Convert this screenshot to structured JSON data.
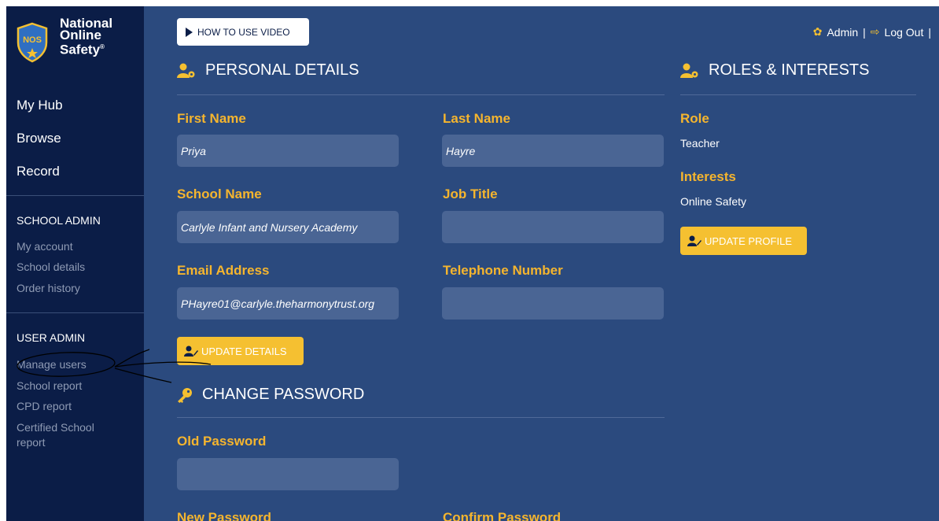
{
  "brand": {
    "badge": "NOS",
    "line1": "National",
    "line2": "Online",
    "line3": "Safety",
    "mark": "®"
  },
  "nav": {
    "items": [
      "My Hub",
      "Browse",
      "Record"
    ]
  },
  "school_admin": {
    "title": "SCHOOL ADMIN",
    "links": [
      "My account",
      "School details",
      "Order history"
    ]
  },
  "user_admin": {
    "title": "USER ADMIN",
    "links": [
      "Manage users",
      "School report",
      "CPD report",
      "Certified School",
      "report"
    ]
  },
  "topbar": {
    "video_label": "HOW TO USE VIDEO",
    "admin_label": "Admin",
    "separator": "|",
    "logout_label": "Log Out"
  },
  "personal": {
    "heading": "PERSONAL DETAILS",
    "first_name": {
      "label": "First Name",
      "value": "Priya"
    },
    "last_name": {
      "label": "Last Name",
      "value": "Hayre"
    },
    "school_name": {
      "label": "School Name",
      "value": "Carlyle Infant and Nursery Academy"
    },
    "job_title": {
      "label": "Job Title",
      "value": ""
    },
    "email": {
      "label": "Email Address",
      "value": "PHayre01@carlyle.theharmonytrust.org"
    },
    "telephone": {
      "label": "Telephone Number",
      "value": ""
    },
    "update_label": "UPDATE DETAILS"
  },
  "roles": {
    "heading": "ROLES & INTERESTS",
    "role_label": "Role",
    "role_value": "Teacher",
    "interests_label": "Interests",
    "interests_value": "Online Safety",
    "update_label": "UPDATE PROFILE"
  },
  "password": {
    "heading": "CHANGE PASSWORD",
    "old_label": "Old Password",
    "old_value": "",
    "new_label": "New Password",
    "confirm_label": "Confirm Password"
  },
  "colors": {
    "sidebar": "#0b1d47",
    "main": "#2b4a7e",
    "accent": "#f5c031",
    "field": "#4a6594",
    "label": "#f5b52e"
  }
}
